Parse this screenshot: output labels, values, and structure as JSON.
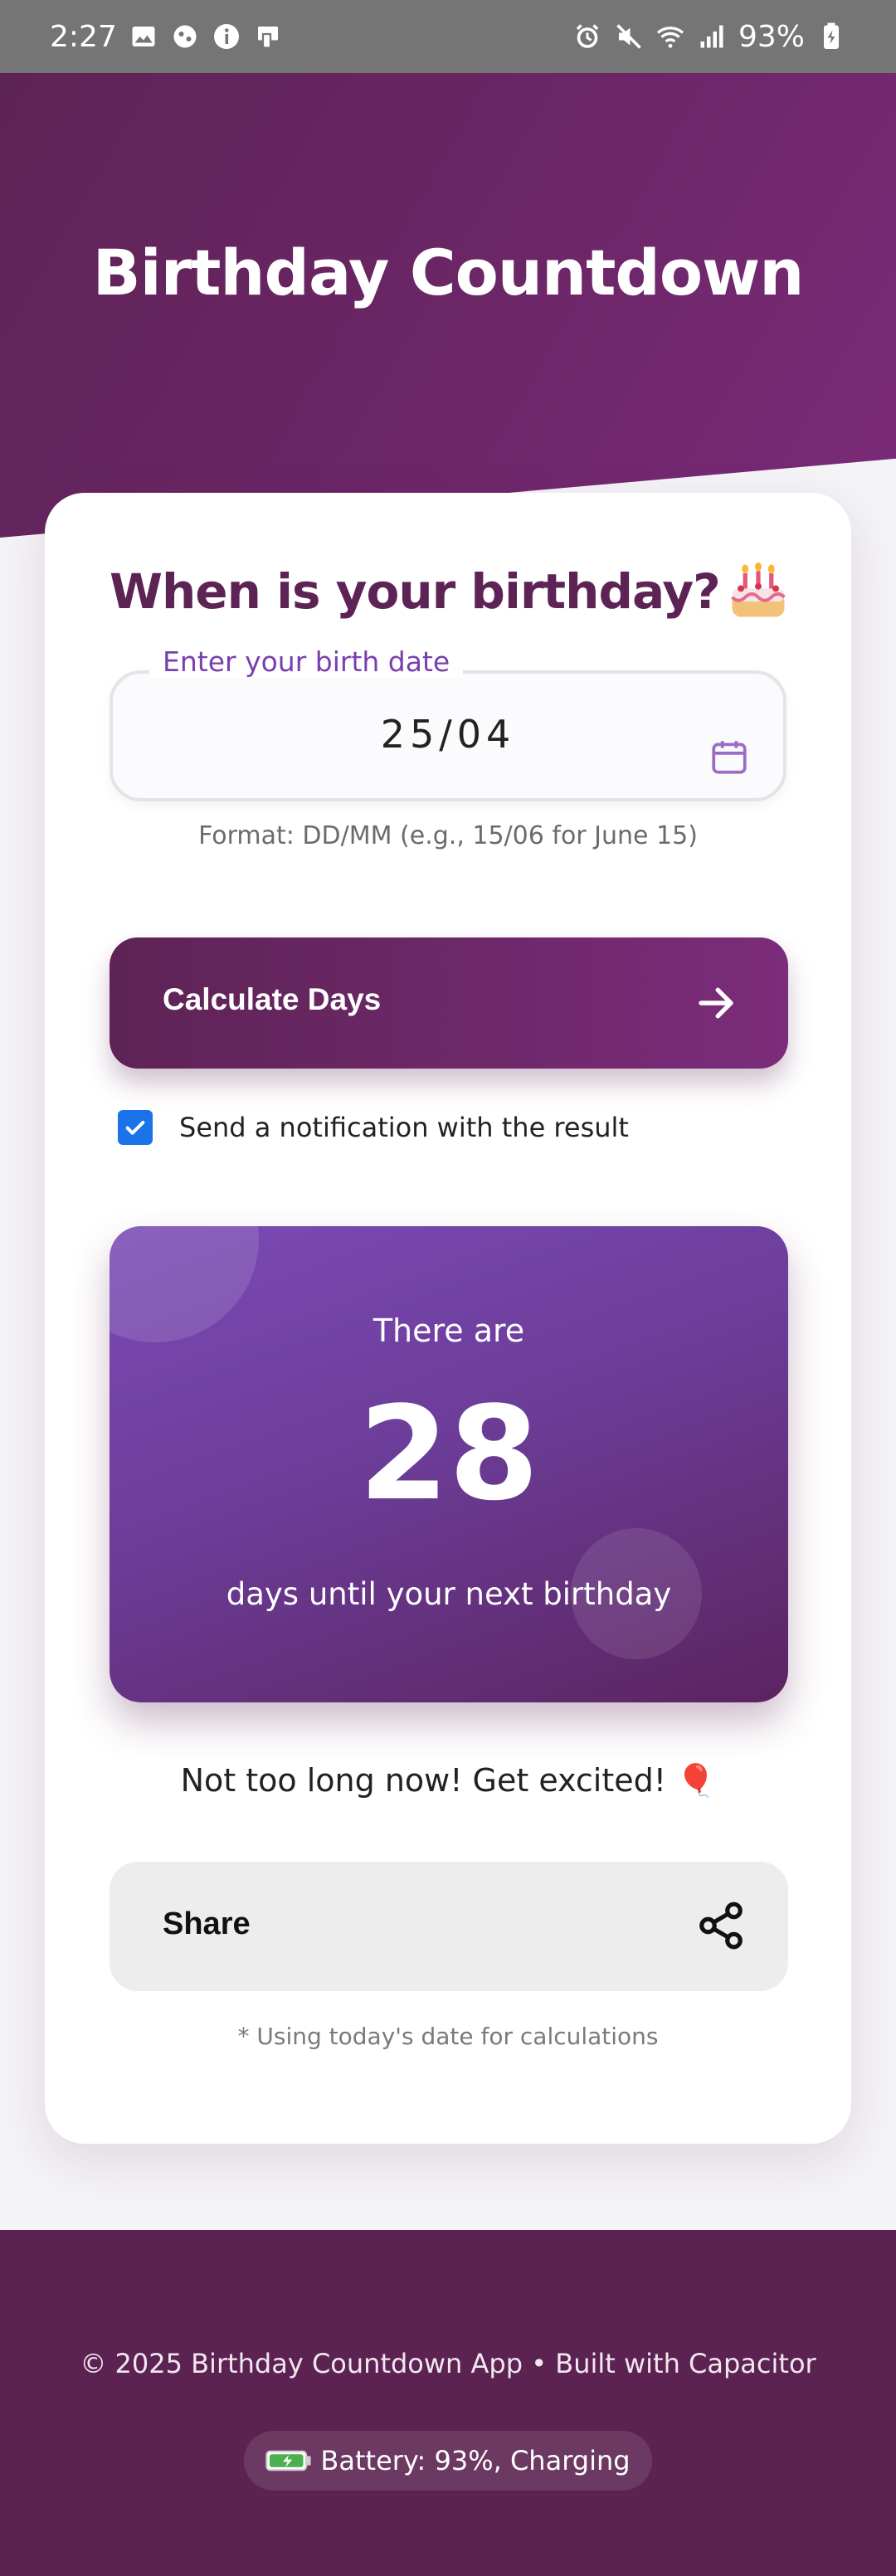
{
  "status_bar": {
    "time": "2:27",
    "battery": "93%",
    "left_icons": [
      "image-icon",
      "media-icon",
      "info-icon",
      "device-icon"
    ],
    "right_icons": [
      "alarm-icon",
      "mute-icon",
      "wifi-icon",
      "signal-icon",
      "battery-charging-icon"
    ]
  },
  "header": {
    "title": "Birthday Countdown"
  },
  "form": {
    "question": "When is your birthday?",
    "emoji_icon": "birthday-cake-icon",
    "date_label": "Enter your birth date",
    "date_value": "25/04",
    "format_hint": "Format: DD/MM (e.g., 15/06 for June 15)",
    "calculate_label": "Calculate Days",
    "notify_label": "Send a notification with the result",
    "notify_checked": true
  },
  "result": {
    "prefix": "There are",
    "days": "28",
    "suffix": "days until your next birthday"
  },
  "message": "Not too long now! Get excited! 🎈",
  "share_label": "Share",
  "date_note": "* Using today's date for calculations",
  "footer": {
    "copyright": "© 2025 Birthday Countdown App • Built with Capacitor",
    "battery_status": "Battery: 93%, Charging"
  },
  "colors": {
    "primary": "#5e2355",
    "accent": "#7b2c7a",
    "result_card": "#6c3d99",
    "checkbox": "#1a73e8"
  }
}
